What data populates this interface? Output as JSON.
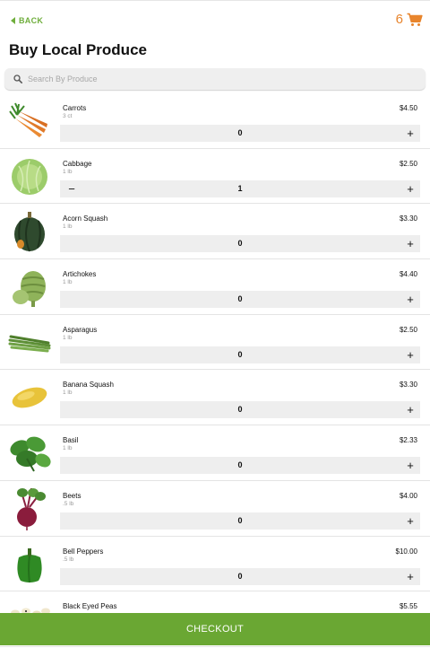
{
  "header": {
    "back_label": "BACK",
    "cart_count": "6",
    "title": "Buy Local Produce"
  },
  "search": {
    "placeholder": "Search By Produce",
    "value": ""
  },
  "colors": {
    "accent_green": "#6fae3c",
    "checkout_green": "#6aa733",
    "cart_orange": "#e8852d"
  },
  "items": [
    {
      "name": "Carrots",
      "unit": "3 ct",
      "price": "$4.50",
      "qty": "0",
      "icon": "carrots-image"
    },
    {
      "name": "Cabbage",
      "unit": "1 lb",
      "price": "$2.50",
      "qty": "1",
      "icon": "cabbage-image"
    },
    {
      "name": "Acorn Squash",
      "unit": "1 lb",
      "price": "$3.30",
      "qty": "0",
      "icon": "acorn-squash-image"
    },
    {
      "name": "Artichokes",
      "unit": "1 lb",
      "price": "$4.40",
      "qty": "0",
      "icon": "artichoke-image"
    },
    {
      "name": "Asparagus",
      "unit": "1 lb",
      "price": "$2.50",
      "qty": "0",
      "icon": "asparagus-image"
    },
    {
      "name": "Banana Squash",
      "unit": "1 lb",
      "price": "$3.30",
      "qty": "0",
      "icon": "banana-squash-image"
    },
    {
      "name": "Basil",
      "unit": "1 lb",
      "price": "$2.33",
      "qty": "0",
      "icon": "basil-image"
    },
    {
      "name": "Beets",
      "unit": ".5 lb",
      "price": "$4.00",
      "qty": "0",
      "icon": "beets-image"
    },
    {
      "name": "Bell Peppers",
      "unit": ".5 lb",
      "price": "$10.00",
      "qty": "0",
      "icon": "bell-pepper-image"
    },
    {
      "name": "Black Eyed Peas",
      "unit": "",
      "price": "$5.55",
      "qty": "",
      "icon": "black-eyed-peas-image"
    }
  ],
  "checkout_label": "CHECKOUT"
}
